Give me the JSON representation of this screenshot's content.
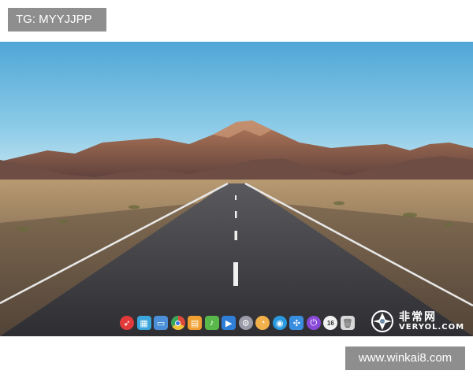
{
  "watermark_top": "TG: MYYJJPP",
  "watermark_bottom": "www.winkai8.com",
  "logo": {
    "name_cn": "非常网",
    "name_en": "VERYOL.COM"
  },
  "dock": {
    "items": [
      {
        "name": "launcher-icon",
        "color": "#e23a3a"
      },
      {
        "name": "desktop-icon",
        "color": "#3aa6dc"
      },
      {
        "name": "file-manager-icon",
        "color": "#4a8fd8"
      },
      {
        "name": "chrome-icon",
        "color": "#e04a3a"
      },
      {
        "name": "app-store-icon",
        "color": "#f0a030"
      },
      {
        "name": "music-icon",
        "color": "#58b84a"
      },
      {
        "name": "video-icon",
        "color": "#2f7fd8"
      },
      {
        "name": "settings-icon",
        "color": "#9a9aa8"
      },
      {
        "name": "clock-icon",
        "color": "#f2b04a"
      },
      {
        "name": "browser-icon",
        "color": "#2a9ae0"
      },
      {
        "name": "network-icon",
        "color": "#3a8ee0"
      },
      {
        "name": "power-icon",
        "color": "#8a4ad8"
      },
      {
        "name": "calendar-icon",
        "color": "#e8e8e8"
      },
      {
        "name": "trash-icon",
        "color": "#d8d8d8"
      }
    ],
    "calendar_text": "16"
  }
}
